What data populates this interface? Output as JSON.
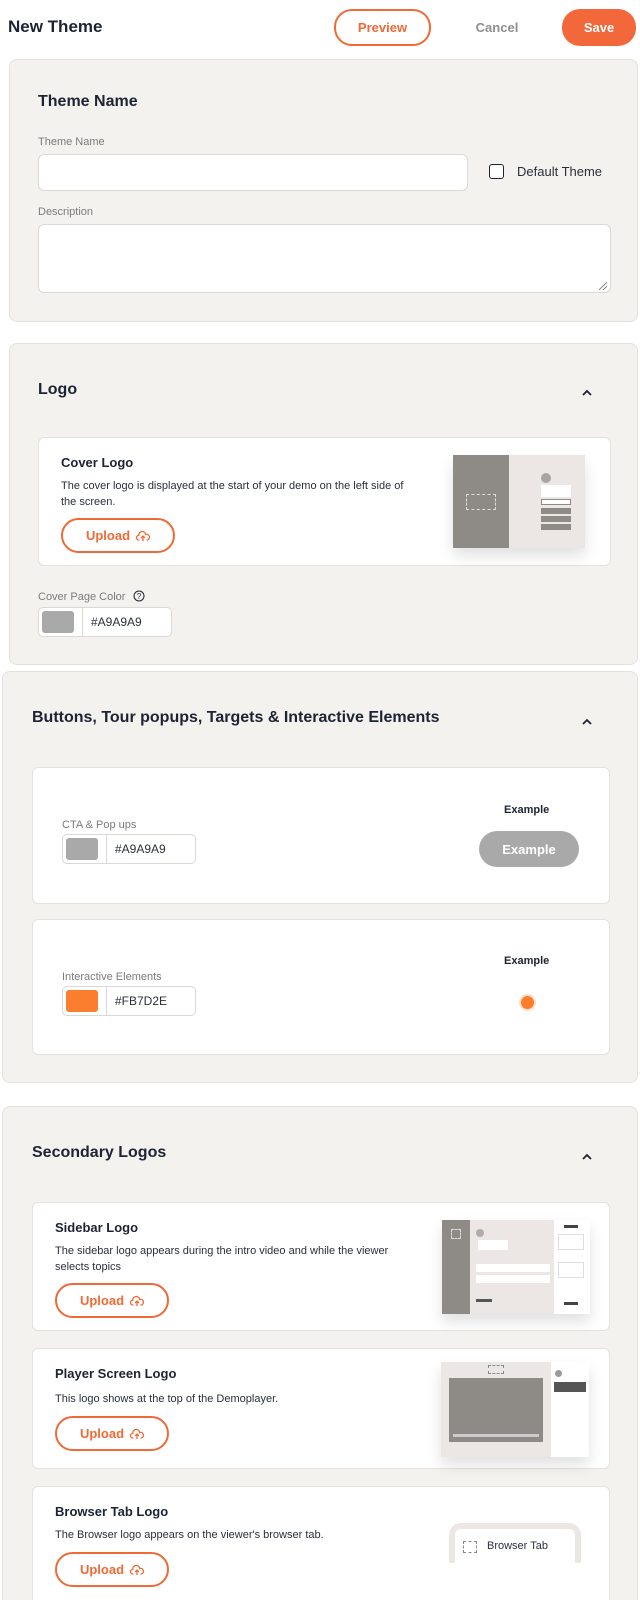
{
  "header": {
    "title": "New Theme",
    "preview_label": "Preview",
    "cancel_label": "Cancel",
    "save_label": "Save"
  },
  "theme_name": {
    "section_title": "Theme Name",
    "name_label": "Theme Name",
    "name_value": "",
    "default_label": "Default Theme",
    "default_checked": false,
    "description_label": "Description",
    "description_value": ""
  },
  "logo": {
    "section_title": "Logo",
    "cover": {
      "title": "Cover Logo",
      "description": "The cover logo is displayed at the start of your demo on the left side of the screen.",
      "upload_label": "Upload"
    },
    "cover_color_label": "Cover Page Color",
    "cover_color": "#A9A9A9"
  },
  "buttons": {
    "section_title": "Buttons, Tour popups, Targets & Interactive Elements",
    "cta": {
      "label": "CTA & Pop ups",
      "color": "#A9A9A9",
      "example_heading": "Example",
      "example_button": "Example"
    },
    "interactive": {
      "label": "Interactive Elements",
      "color": "#FB7D2E",
      "example_heading": "Example"
    }
  },
  "secondary": {
    "section_title": "Secondary Logos",
    "sidebar": {
      "title": "Sidebar Logo",
      "description": "The sidebar logo appears during the intro video and while the viewer selects topics",
      "upload_label": "Upload"
    },
    "player": {
      "title": "Player Screen Logo",
      "description": "This logo shows at the top of the Demoplayer.",
      "upload_label": "Upload"
    },
    "browser": {
      "title": "Browser Tab Logo",
      "description": "The Browser logo appears on the viewer's browser tab.",
      "upload_label": "Upload",
      "tab_label": "Browser Tab"
    }
  },
  "colors": {
    "accent": "#EF6A35",
    "panel_bg": "#F4F2EF"
  }
}
